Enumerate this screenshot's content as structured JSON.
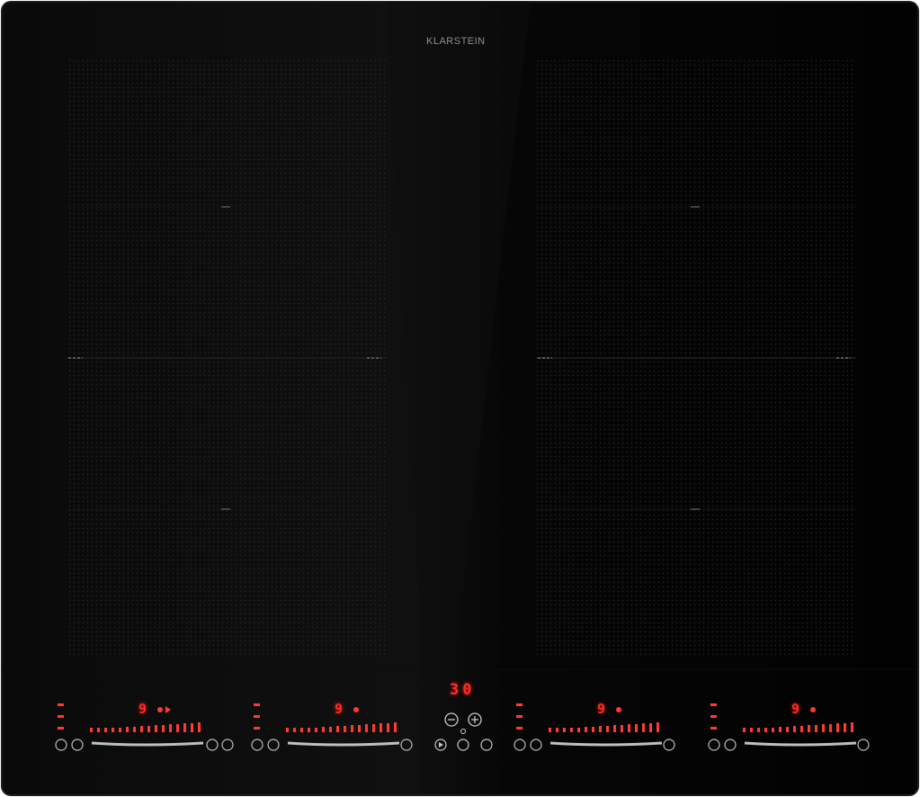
{
  "brand": "KLARSTEIN",
  "timer_display": "30",
  "zones": [
    {
      "name": "front-left",
      "level_display": "9"
    },
    {
      "name": "rear-left",
      "level_display": "9"
    },
    {
      "name": "rear-right",
      "level_display": "9"
    },
    {
      "name": "front-right",
      "level_display": "9"
    }
  ],
  "colors": {
    "glass": "#040404",
    "display_red": "#ff2a22",
    "control_icon": "#bfbfbf",
    "brand_text": "#8f8f8f"
  }
}
